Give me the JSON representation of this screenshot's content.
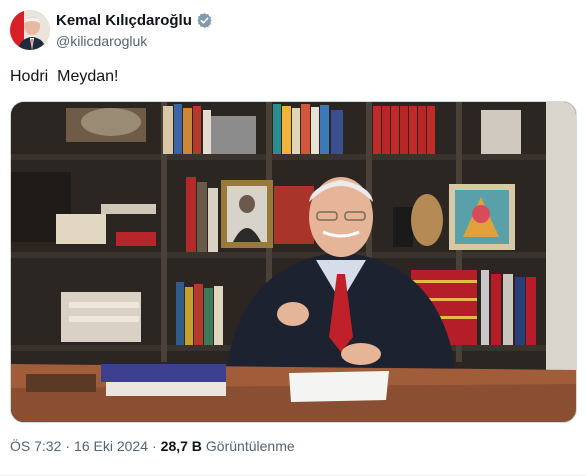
{
  "author": {
    "display_name": "Kemal Kılıçdaroğlu",
    "handle": "@kilicdarogluk",
    "verified_icon": "verified-badge-icon",
    "avatar_icon": "avatar"
  },
  "tweet": {
    "text": "Hodri  Meydan!"
  },
  "media": {
    "kind": "video-still",
    "description_icon": "video-thumbnail"
  },
  "meta": {
    "time": "ÖS 7:32",
    "separator": "·",
    "date": "16 Eki 2024",
    "views_count": "28,7 B",
    "views_label": "Görüntülenme"
  },
  "colors": {
    "text_primary": "#0f1419",
    "text_secondary": "#536471",
    "verified": "#829aab",
    "border": "#cfd9de"
  }
}
